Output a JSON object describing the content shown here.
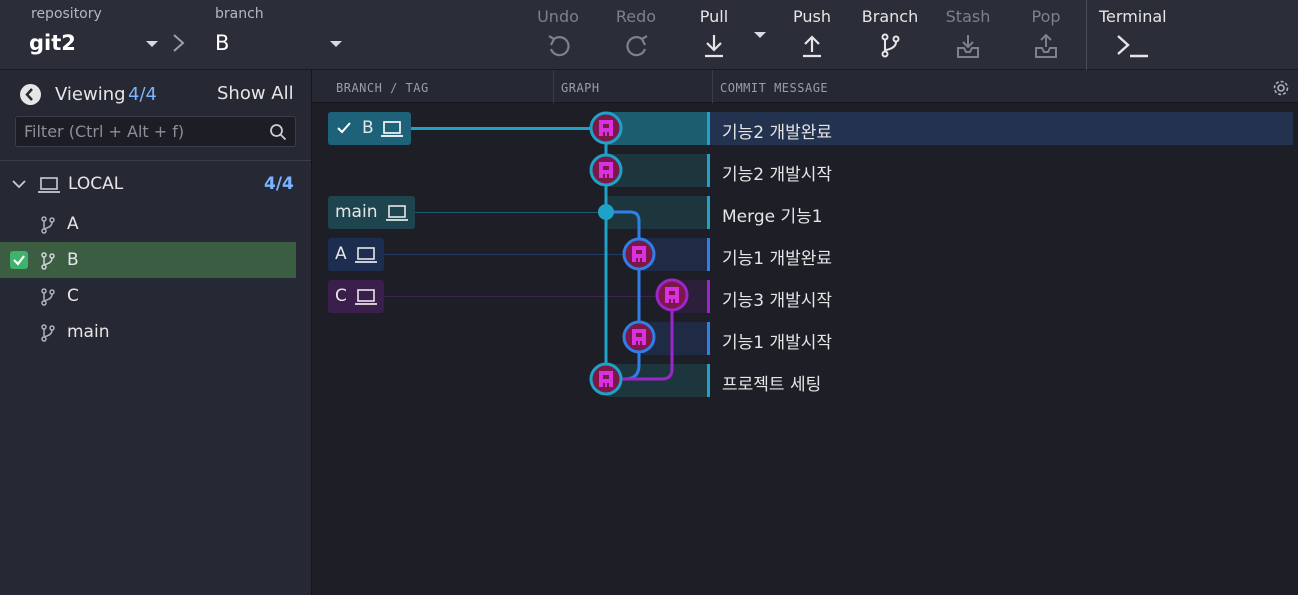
{
  "toolbar": {
    "repository_label": "repository",
    "repository_value": "git2",
    "branch_label": "branch",
    "branch_value": "B",
    "buttons": {
      "undo": "Undo",
      "redo": "Redo",
      "pull": "Pull",
      "push": "Push",
      "branch": "Branch",
      "stash": "Stash",
      "pop": "Pop",
      "terminal": "Terminal"
    }
  },
  "left_panel": {
    "viewing_label": "Viewing",
    "viewing_count": "4/4",
    "show_all": "Show All",
    "filter_placeholder": "Filter (Ctrl + Alt + f)",
    "local": {
      "label": "LOCAL",
      "count": "4/4"
    },
    "branches": [
      {
        "name": "A",
        "active": false
      },
      {
        "name": "B",
        "active": true
      },
      {
        "name": "C",
        "active": false
      },
      {
        "name": "main",
        "active": false
      }
    ]
  },
  "columns": {
    "branch_tag": "BRANCH / TAG",
    "graph": "GRAPH",
    "commit_message": "COMMIT MESSAGE"
  },
  "commits": [
    {
      "message": "기능2 개발완료",
      "tag": "B",
      "checked": true,
      "selected": true
    },
    {
      "message": "기능2 개발시작"
    },
    {
      "message": "Merge 기능1",
      "tag": "main"
    },
    {
      "message": "기능1 개발완료",
      "tag": "A"
    },
    {
      "message": "기능3 개발시작",
      "tag": "C"
    },
    {
      "message": "기능1 개발시작"
    },
    {
      "message": "프로젝트 세팅"
    }
  ],
  "colors": {
    "lane_teal": "#1ea2c8",
    "lane_blue": "#2f7fe6",
    "lane_purple": "#9b26c9",
    "selected_row": "#22324f",
    "active_branch": "#3b5e43",
    "accent_count": "#7ab4ff"
  }
}
